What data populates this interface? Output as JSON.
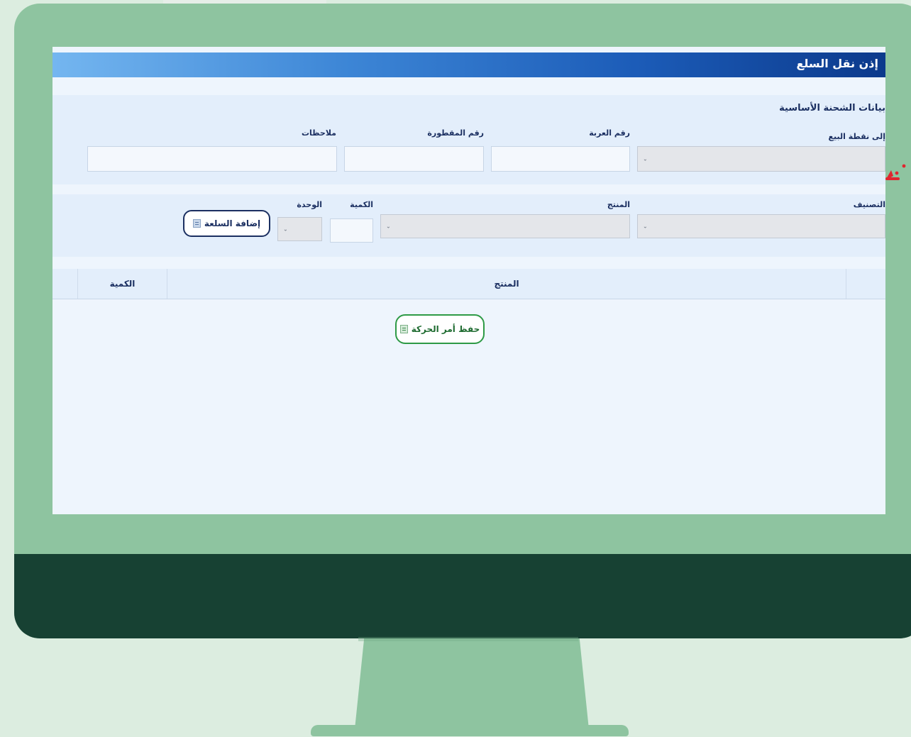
{
  "window": {
    "title": "إذن نقل السلع"
  },
  "shipment_section": {
    "heading": "بيانات الشحنة الأساسية",
    "to_point_label": "إلى نقطة البيع",
    "vehicle_number_label": "رقم العربة",
    "trailer_number_label": "رقم المقطورة",
    "notes_label": "ملاحظات",
    "vehicle_number_value": "",
    "trailer_number_value": "",
    "notes_value": "",
    "to_point_value": ""
  },
  "item_section": {
    "category_label": "التصنيف",
    "product_label": "المنتج",
    "quantity_label": "الكمية",
    "unit_label": "الوحدة",
    "category_value": "",
    "product_value": "",
    "quantity_value": "",
    "unit_value": "",
    "add_item_button": "إضافة السلعة"
  },
  "table": {
    "columns": [
      "المنتج",
      "الكمية"
    ],
    "rows": []
  },
  "actions": {
    "save_button": "حفظ أمر الحركة"
  },
  "colors": {
    "monitor": "#8ec4a0",
    "monitor_chin": "#174133",
    "page_background": "#dcede0",
    "screen_background": "#eef5fd",
    "titlebar_dark": "#0c3a8c",
    "titlebar_light": "#74b6f0",
    "text_navy": "#1b2f61",
    "save_green": "#2e9a46",
    "pointer_red": "#e0262f"
  },
  "icons": {
    "dropdown": "chevron-down-icon",
    "add": "clipboard-icon",
    "save": "clipboard-icon",
    "pointer": "red-arrow-icon"
  }
}
